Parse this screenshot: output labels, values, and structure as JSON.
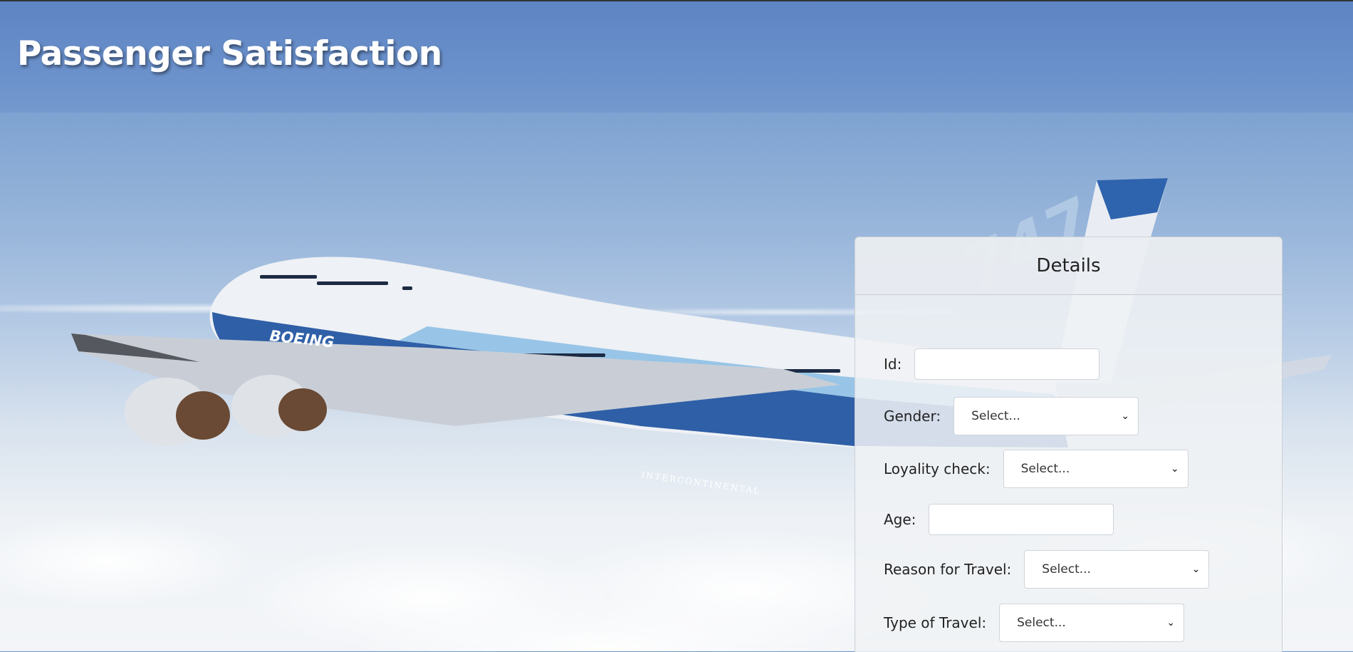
{
  "header": {
    "title": "Passenger Satisfaction"
  },
  "card": {
    "title": "Details",
    "fields": {
      "id": {
        "label": "Id:",
        "value": ""
      },
      "gender": {
        "label": "Gender:",
        "selected": "Select..."
      },
      "loyalty": {
        "label": "Loyality check:",
        "selected": "Select..."
      },
      "age": {
        "label": "Age:",
        "value": ""
      },
      "reason": {
        "label": "Reason for Travel:",
        "selected": "Select..."
      },
      "type": {
        "label": "Type of Travel:",
        "selected": "Select..."
      }
    }
  },
  "plane": {
    "brand": "BOEING",
    "livery": "INTERCONTINENTAL",
    "tail_number": "747"
  },
  "icons": {
    "select_arrow": "chevron-down-icon"
  },
  "colors": {
    "header_bg": "#6a90cb",
    "title_text": "#ffffff",
    "fuselage_blue": "#2c5aa0"
  }
}
